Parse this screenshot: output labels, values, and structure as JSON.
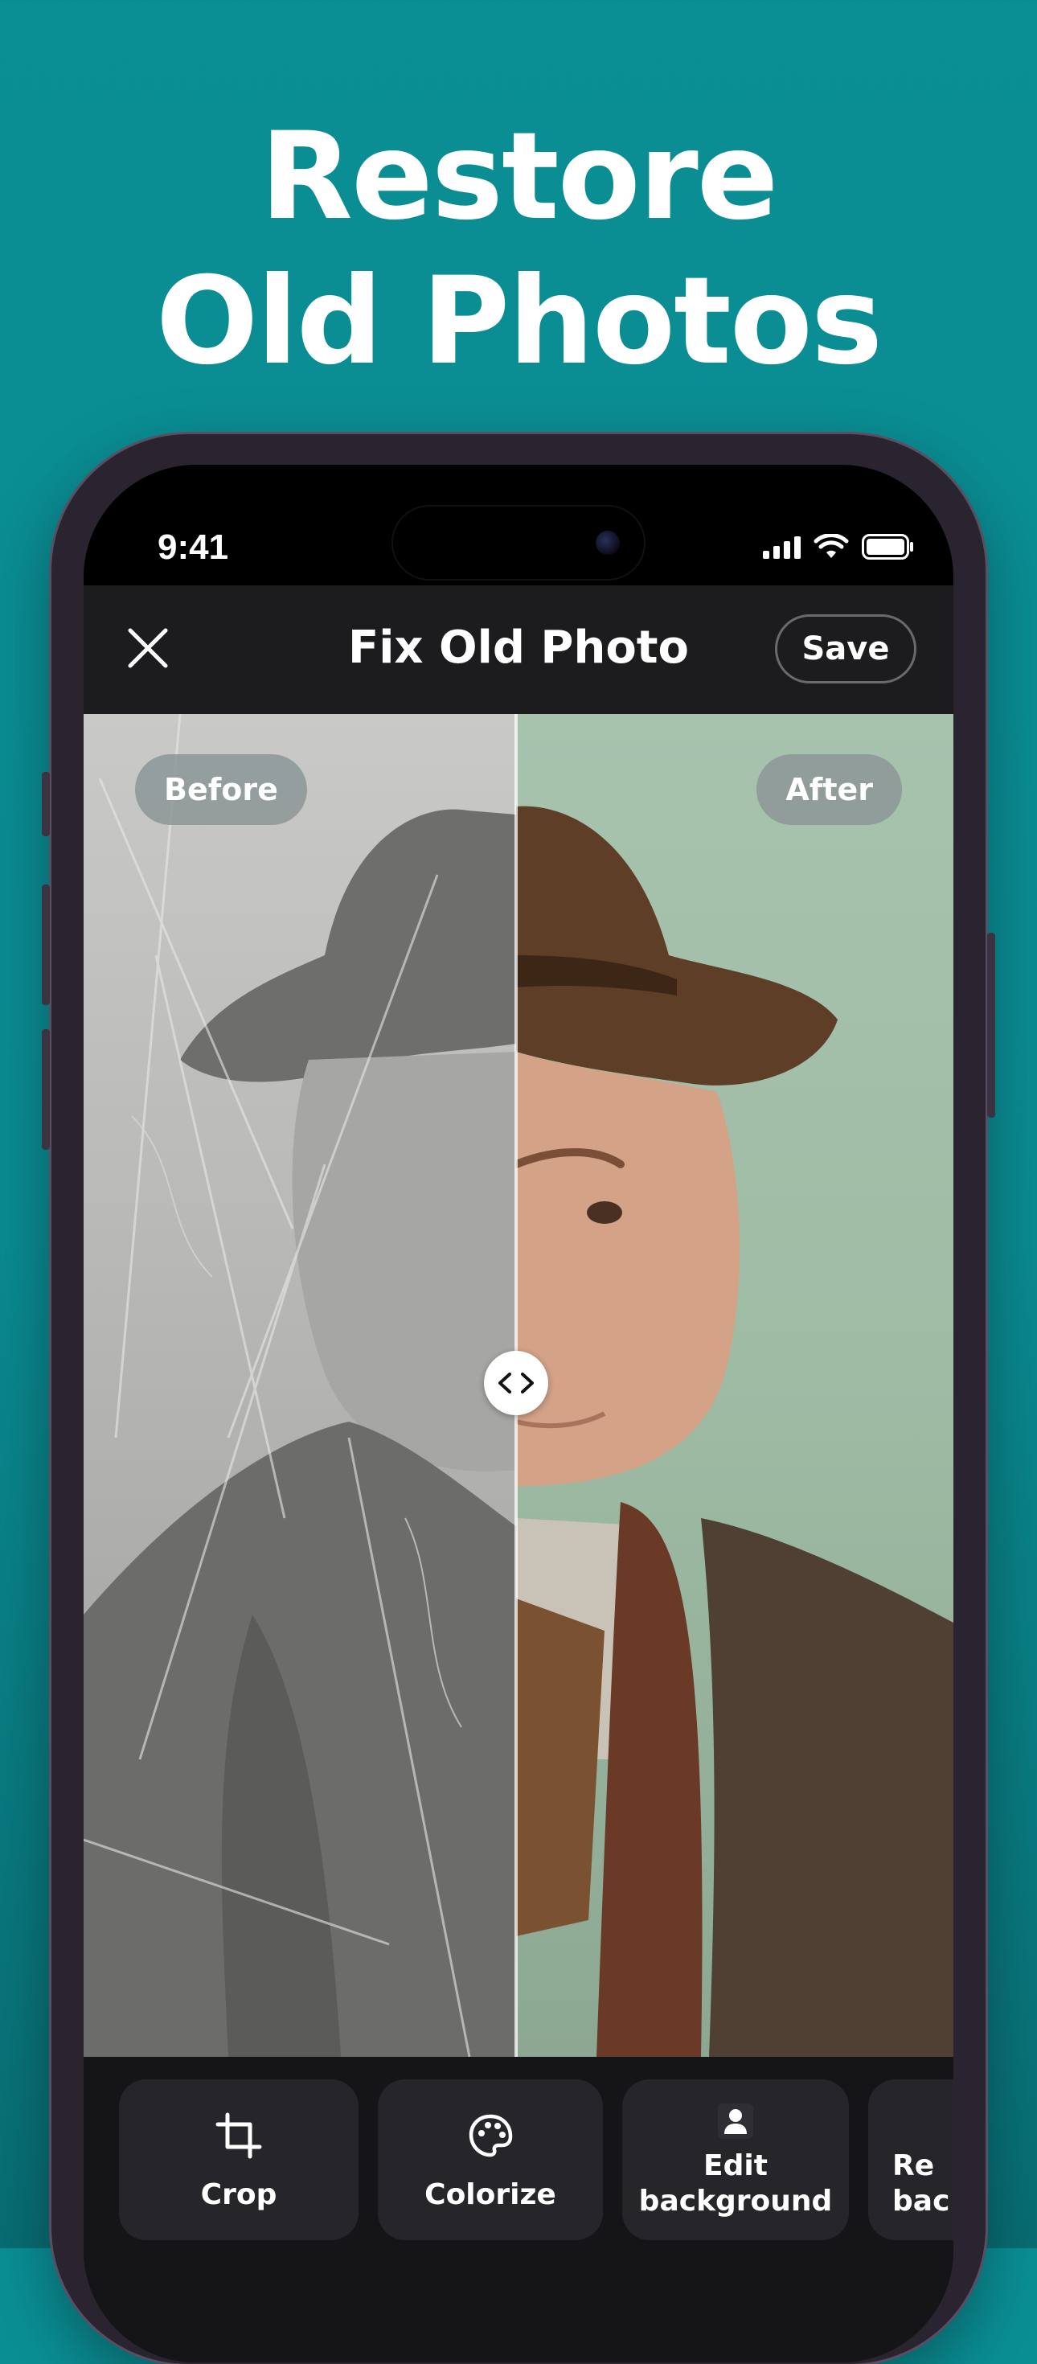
{
  "headline": {
    "line1": "Restore",
    "line2": "Old Photos"
  },
  "status_bar": {
    "time": "9:41"
  },
  "app": {
    "title": "Fix Old Photo",
    "save_label": "Save",
    "compare": {
      "before_label": "Before",
      "after_label": "After"
    },
    "tools": [
      {
        "label": "Crop",
        "icon": "crop-icon"
      },
      {
        "label": "Colorize",
        "icon": "palette-icon"
      },
      {
        "label": "Edit\nbackground",
        "icon": "person-icon"
      },
      {
        "label": "Re\nbac",
        "icon": ""
      }
    ]
  },
  "colors": {
    "background": "#0a8f95",
    "app_header": "#1c1c1e",
    "toolbar": "#151517",
    "tool_card": "#26262a",
    "after_background": "#a7c3ae"
  }
}
